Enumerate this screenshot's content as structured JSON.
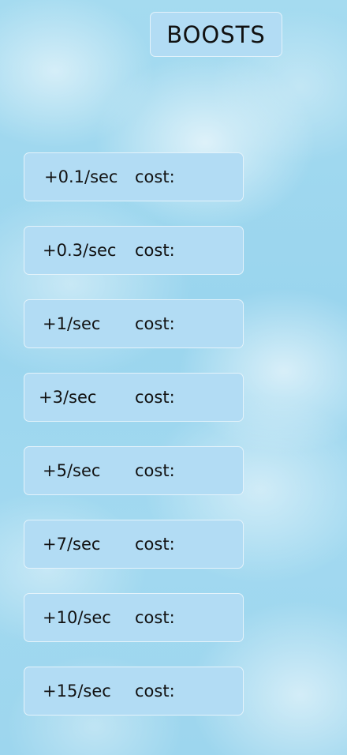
{
  "header": {
    "title": "BOOSTS"
  },
  "boosts": [
    {
      "rate": "+0.1/sec",
      "cost_label": "cost:"
    },
    {
      "rate": "+0.3/sec",
      "cost_label": "cost:"
    },
    {
      "rate": "+1/sec",
      "cost_label": "cost:"
    },
    {
      "rate": "+3/sec",
      "cost_label": "cost:"
    },
    {
      "rate": "+5/sec",
      "cost_label": "cost:"
    },
    {
      "rate": "+7/sec",
      "cost_label": "cost:"
    },
    {
      "rate": "+10/sec",
      "cost_label": "cost:"
    },
    {
      "rate": "+15/sec",
      "cost_label": "cost:"
    }
  ],
  "colors": {
    "panel": "#b2dcf4",
    "panel_border": "#e4f3fb",
    "sky": "#9ad5ee"
  }
}
